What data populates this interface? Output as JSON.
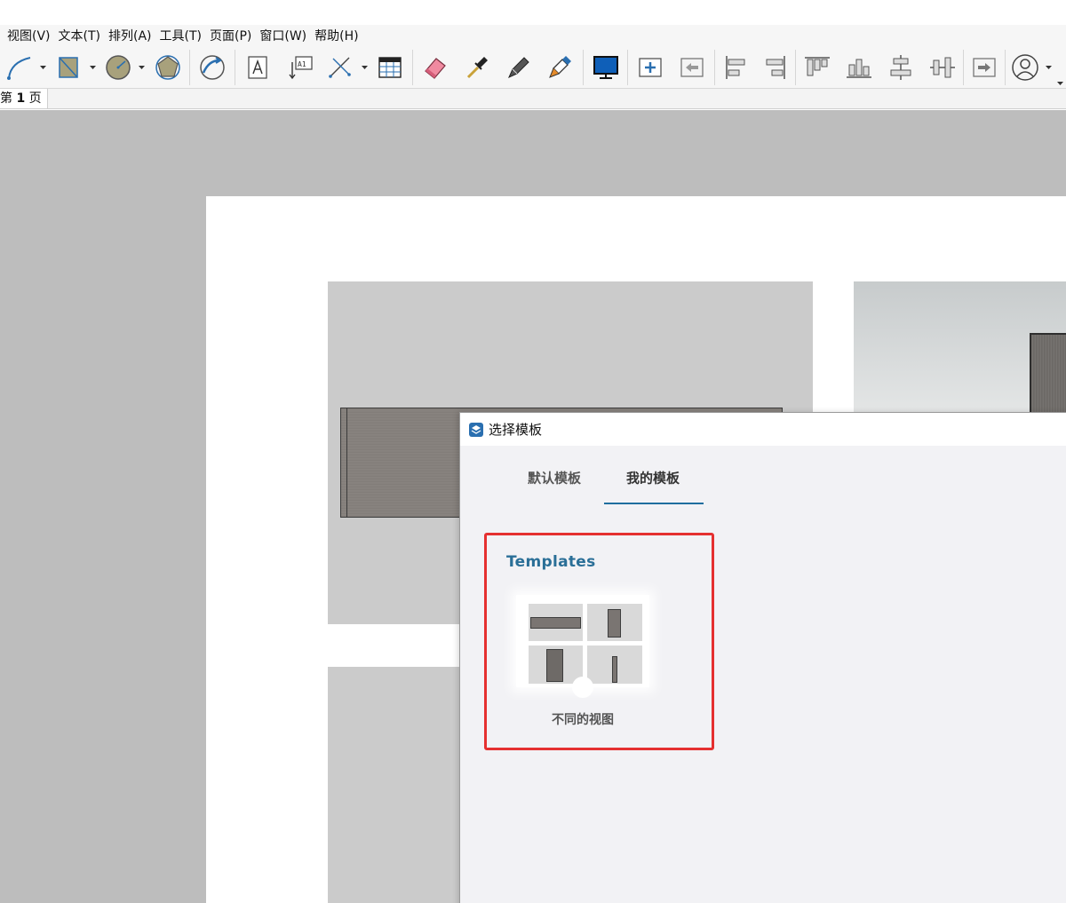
{
  "menubar": {
    "items": [
      "视图(V)",
      "文本(T)",
      "排列(A)",
      "工具(T)",
      "页面(P)",
      "窗口(W)",
      "帮助(H)"
    ]
  },
  "toolbar": {
    "tools": [
      {
        "name": "line-tool-icon"
      },
      {
        "name": "rectangle-tool-icon"
      },
      {
        "name": "circle-tool-icon"
      },
      {
        "name": "polygon-tool-icon"
      },
      {
        "name": "arc-tool-icon"
      },
      {
        "name": "text-tool-icon"
      },
      {
        "name": "label-tool-icon"
      },
      {
        "name": "dimension-tool-icon"
      },
      {
        "name": "table-tool-icon"
      },
      {
        "name": "eraser-tool-icon"
      },
      {
        "name": "eyedropper-tool-icon"
      },
      {
        "name": "split-tool-icon"
      },
      {
        "name": "join-tool-icon"
      },
      {
        "name": "presentation-icon"
      },
      {
        "name": "add-page-icon"
      },
      {
        "name": "previous-page-icon"
      },
      {
        "name": "align-left-icon"
      },
      {
        "name": "align-right-icon"
      },
      {
        "name": "align-top-icon"
      },
      {
        "name": "align-bottom-icon"
      },
      {
        "name": "align-center-vertical-icon"
      },
      {
        "name": "align-center-horizontal-icon"
      },
      {
        "name": "next-page-icon"
      },
      {
        "name": "user-account-icon"
      }
    ]
  },
  "pagetabs": {
    "prefix": "第",
    "number": "1",
    "suffix": "页"
  },
  "dialog": {
    "title": "选择模板",
    "tabs": {
      "default": "默认模板",
      "mine": "我的模板"
    },
    "templates": {
      "heading": "Templates",
      "items": [
        {
          "name": "不同的视图"
        }
      ]
    }
  },
  "colors": {
    "tab_underline": "#1f6e9e",
    "highlight_border": "#e53030",
    "heading": "#2a6f97"
  }
}
